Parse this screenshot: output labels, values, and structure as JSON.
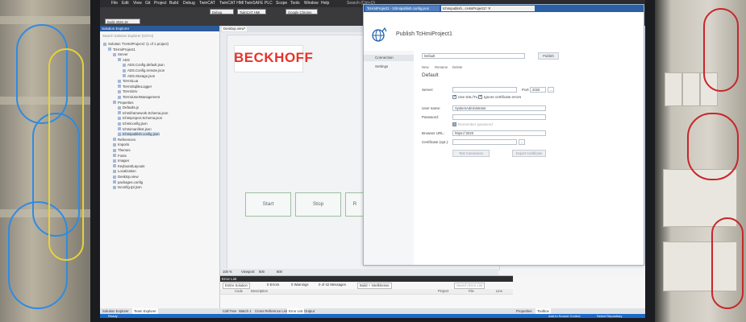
{
  "ide": {
    "menu": [
      "File",
      "Edit",
      "View",
      "Git",
      "Project",
      "Build",
      "Debug",
      "TwinCAT",
      "TwinCAT HMI",
      "TwinSAFE",
      "PLC",
      "Scope",
      "Tools",
      "Window",
      "Help"
    ],
    "search_placeholder": "Search (Ctrl+Q)",
    "config": "Debug",
    "platform": "TwinCAT HMI",
    "browser": "Google Chrome",
    "build_combo": "Build 4026.19 (Default)"
  },
  "solution_explorer": {
    "title": "Solution Explorer",
    "search_placeholder": "Search Solution Explorer (Ctrl+ü)",
    "items": [
      {
        "label": "Solution 'TcHmiProject1' (1 of 1 project)",
        "indent": 0
      },
      {
        "label": "TcHmiProject1",
        "indent": 1
      },
      {
        "label": "Server",
        "indent": 2
      },
      {
        "label": "ADS",
        "indent": 3
      },
      {
        "label": "ADS.Config.default.json",
        "indent": 4
      },
      {
        "label": "ADS.Config.remote.json",
        "indent": 4
      },
      {
        "label": "ADS.Storage.json",
        "indent": 4
      },
      {
        "label": "TcHmiLua",
        "indent": 3
      },
      {
        "label": "TcHmiSqliteLogger",
        "indent": 3
      },
      {
        "label": "TcHmiSrv",
        "indent": 3
      },
      {
        "label": "TcHmiUserManagement",
        "indent": 3
      },
      {
        "label": "Properties",
        "indent": 2
      },
      {
        "label": "Defaults.js",
        "indent": 3
      },
      {
        "label": "tchmiframework.Schema.json",
        "indent": 3
      },
      {
        "label": "tchmiproject.Schema.json",
        "indent": 3
      },
      {
        "label": "tchmiconfig.json",
        "indent": 3
      },
      {
        "label": "tchmimanifest.json",
        "indent": 3
      },
      {
        "label": "tchmipublish.config.json",
        "indent": 3,
        "selected": true
      },
      {
        "label": "References",
        "indent": 2
      },
      {
        "label": "Imports",
        "indent": 2
      },
      {
        "label": "Themes",
        "indent": 2
      },
      {
        "label": "Fonts",
        "indent": 2
      },
      {
        "label": "Images",
        "indent": 2
      },
      {
        "label": "KeyboardLayouts",
        "indent": 2
      },
      {
        "label": "Localization",
        "indent": 2
      },
      {
        "label": "Desktop.view",
        "indent": 2
      },
      {
        "label": "packages.config",
        "indent": 2
      },
      {
        "label": "tsconfig.tpl.json",
        "indent": 2
      }
    ],
    "bottom_tabs": [
      "Solution Explorer",
      "Team Explorer"
    ]
  },
  "designer": {
    "tab": "Desktop.view*",
    "logo": "BECKHOFF",
    "buttons": [
      "Start",
      "Stop",
      "R"
    ],
    "zoom": "100 %",
    "viewport_label": "Viewport:",
    "viewport_w": "800",
    "viewport_h": "800"
  },
  "error_list": {
    "title": "Error List",
    "scope": "Entire Solution",
    "errors": "0 Errors",
    "warnings": "0 Warnings",
    "messages": "0 of 42 Messages",
    "filter": "Build + IntelliSense",
    "search_placeholder": "Search Error List",
    "columns": [
      "Code",
      "Description",
      "Project",
      "File",
      "Line"
    ]
  },
  "properties": {
    "tabs": [
      "Properties",
      "Toolbox"
    ]
  },
  "bottom_tabs": [
    "Call Tree",
    "Watch 1",
    "Cross Reference List",
    "Error List",
    "Output"
  ],
  "status": {
    "left": "Ready",
    "right1": "Add to Source Control",
    "right2": "Select Repository"
  },
  "publish": {
    "tab1": "TcHmiProject1 - tchmipublish.config.json",
    "tab2": "tchmipublish...cHmiProject1* ✕",
    "title": "Publish TcHmiProject1",
    "nav": [
      "Connection",
      "Settings"
    ],
    "profile": "Default",
    "publish_btn": "Publish",
    "links": [
      "New",
      "Rename",
      "Delete"
    ],
    "section": "Default",
    "server_label": "Server:",
    "server_value": "",
    "port_label": "Port:",
    "port_value": "2020",
    "port_btn": "...",
    "ssl_label": "Use SSL/TLS",
    "ignore_cert_label": "Ignore certificate errors",
    "user_label": "User name:",
    "user_value": "SystemAdministrator",
    "pw_label": "Password:",
    "pw_value": "",
    "remember_label": "Remember password",
    "browser_label": "Browser URL:",
    "browser_value": "https://:2020",
    "cert_label": "Certificate (opt.):",
    "cert_value": "",
    "cert_btn": "...",
    "test_btn": "Test Connection",
    "export_btn": "Export Certificate"
  },
  "colors": {
    "beckhoff_red": "#e6332a",
    "ide_blue": "#1b6ac9",
    "publish_tab": "#2b5fa6"
  }
}
